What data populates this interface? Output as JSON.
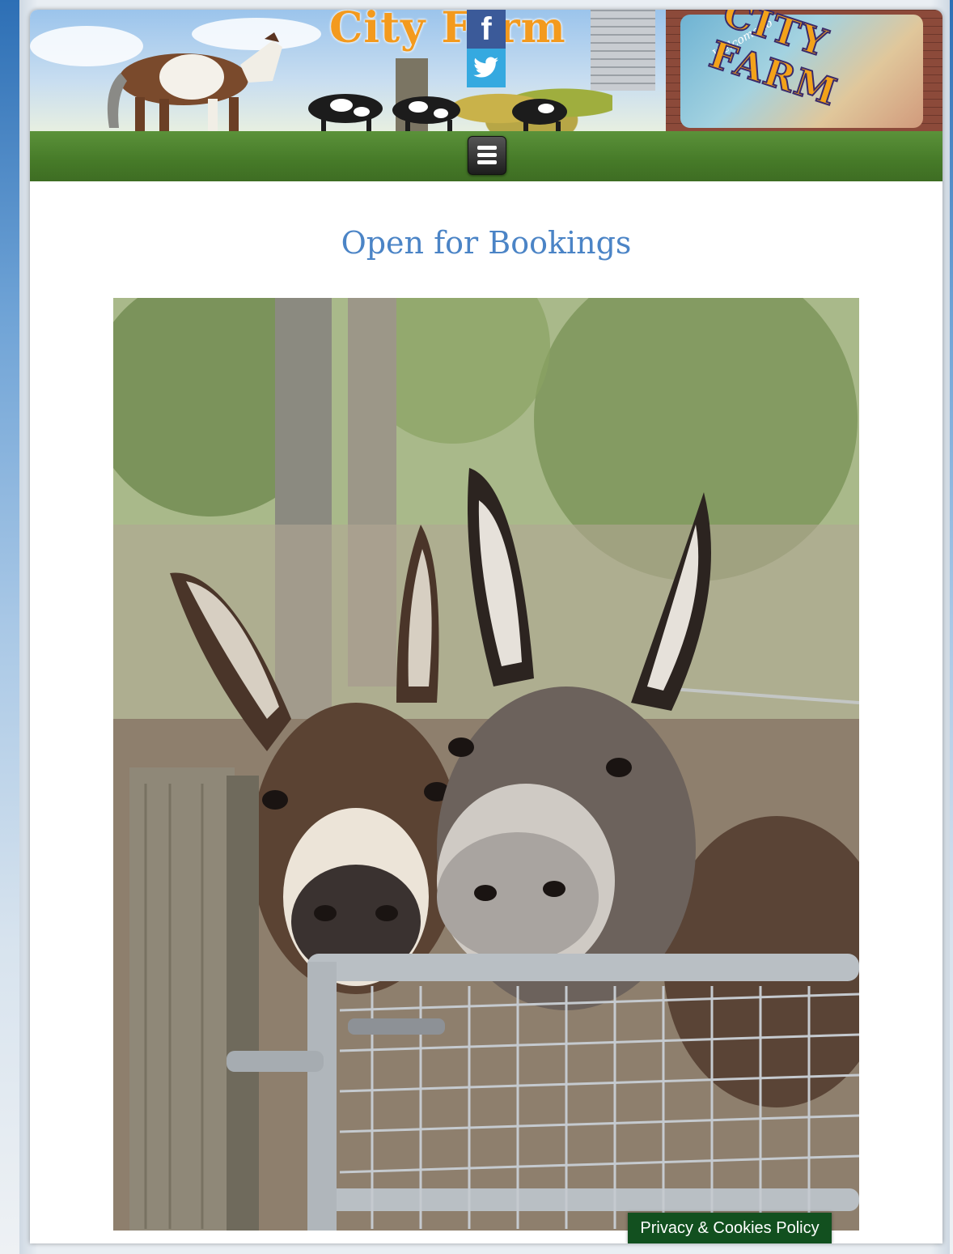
{
  "header": {
    "site_title": "City Farm",
    "social": {
      "facebook_icon": "facebook-icon",
      "twitter_icon": "twitter-icon",
      "facebook_glyph": "f"
    },
    "mural_text": "CITY FARM",
    "mural_welcome": "Welcome to",
    "colors": {
      "title": "#f39a1e",
      "facebook": "#3b5a99",
      "twitter": "#35a9e0",
      "grass": "#4a7e2c"
    }
  },
  "nav": {
    "menu_icon": "hamburger-menu-icon"
  },
  "main": {
    "heading": "Open for Bookings",
    "heading_color": "#4b84c6",
    "photo_subject": "two-donkeys-at-gate"
  },
  "footer": {
    "privacy_label": "Privacy & Cookies Policy",
    "privacy_color": "#12501f"
  }
}
